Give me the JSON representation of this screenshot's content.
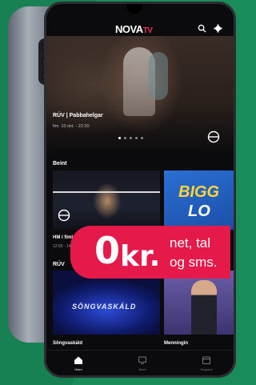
{
  "app": {
    "logo_text": "NOVA",
    "logo_accent": "TV"
  },
  "hero": {
    "title": "RÚV | Pabbahelgar",
    "subtitle": "fim. 10 okt. - 22:20",
    "carousel_count": 5,
    "carousel_active_index": 0
  },
  "sections": {
    "live_title": "Beint",
    "ruv_title": "RÚV"
  },
  "tiles": {
    "live_left_label": "HM í fimleikum",
    "live_left_time": "12:55 - 14:00",
    "live_right_text_1": "BIGG",
    "live_right_text_2": "LO",
    "ruv_left_overlay": "SÖNGVASKÁLD",
    "ruv_left_label": "Söngvaskáld",
    "ruv_right_label": "Menningin"
  },
  "nav": {
    "items": [
      {
        "label": "Heim",
        "active": true
      },
      {
        "label": "Beint",
        "active": false
      },
      {
        "label": "Dagskrá",
        "active": false
      }
    ]
  },
  "promo": {
    "amount": "0",
    "currency": "kr.",
    "line1": "net, tal",
    "line2": "og sms."
  },
  "colors": {
    "background": "#1a8c5a",
    "promo_red": "#e6194b",
    "screen_bg": "#0b0b0d",
    "accent_pink": "#e6325a"
  }
}
